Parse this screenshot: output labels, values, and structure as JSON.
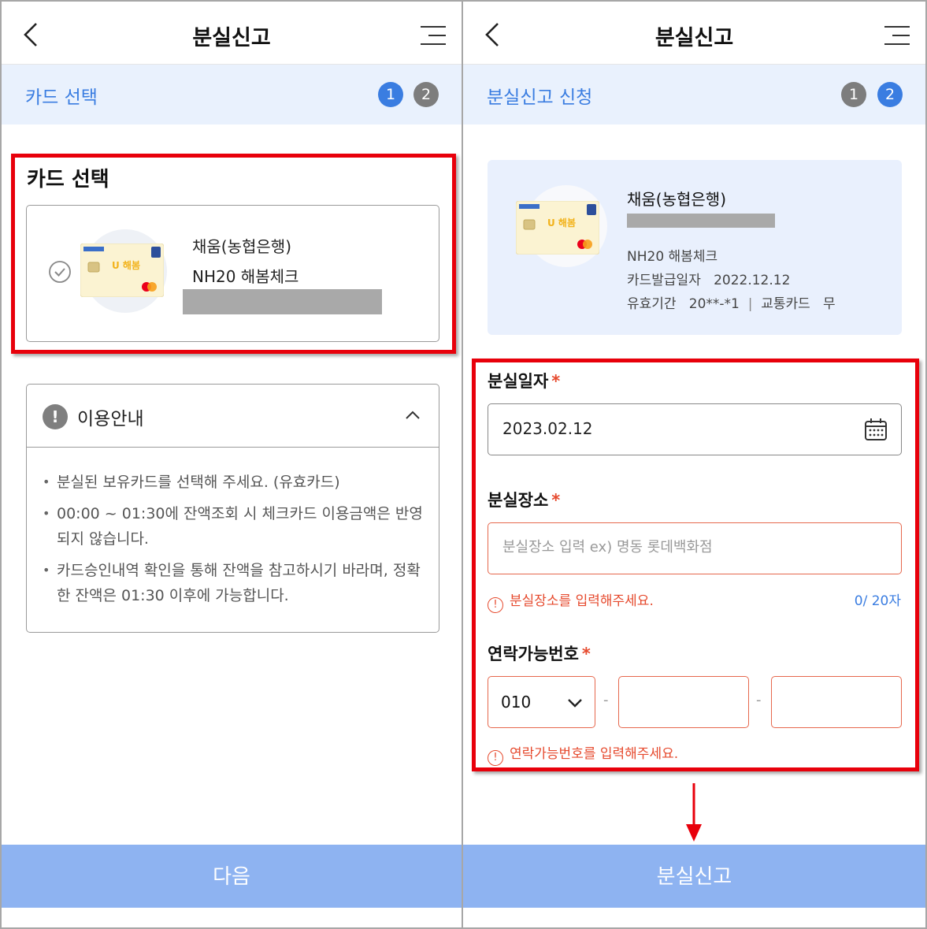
{
  "left": {
    "header": {
      "title": "분실신고"
    },
    "step": {
      "title": "카드 선택",
      "badges": [
        "1",
        "2"
      ]
    },
    "section_title": "카드 선택",
    "card": {
      "name": "채움(농협은행)",
      "product": "NH20 해봄체크"
    },
    "info": {
      "title": "이용안내",
      "items": [
        "분실된 보유카드를 선택해 주세요. (유효카드)",
        "00:00 ~ 01:30에 잔액조회 시 체크카드 이용금액은 반영되지 않습니다.",
        "카드승인내역 확인을 통해 잔액을 참고하시기 바라며, 정확한 잔액은 01:30 이후에 가능합니다."
      ]
    },
    "next_button": "다음"
  },
  "right": {
    "header": {
      "title": "분실신고"
    },
    "step": {
      "title": "분실신고 신청",
      "badges": [
        "1",
        "2"
      ]
    },
    "card": {
      "name": "채움(농협은행)",
      "product": "NH20 해봄체크",
      "issue_label": "카드발급일자",
      "issue_date": "2022.12.12",
      "validity_label": "유효기간",
      "validity_value": "20**-*1",
      "transit_label": "교통카드",
      "transit_value": "무"
    },
    "form": {
      "loss_date_label": "분실일자",
      "loss_date_value": "2023.02.12",
      "loss_place_label": "분실장소",
      "loss_place_placeholder": "분실장소 입력 ex) 명동 롯데백화점",
      "loss_place_error": "분실장소를 입력해주세요.",
      "loss_place_counter": "0/ 20자",
      "phone_label": "연락가능번호",
      "phone_prefix": "010",
      "phone_dash": "-",
      "phone_error": "연락가능번호를 입력해주세요.",
      "required_mark": "*"
    },
    "submit_button": "분실신고"
  },
  "colors": {
    "accent": "#3a7de1",
    "stepbar_bg": "#e9f1fd",
    "button_bg": "#8eb3f1",
    "error": "#e64a2e",
    "highlight": "#e8000b"
  }
}
